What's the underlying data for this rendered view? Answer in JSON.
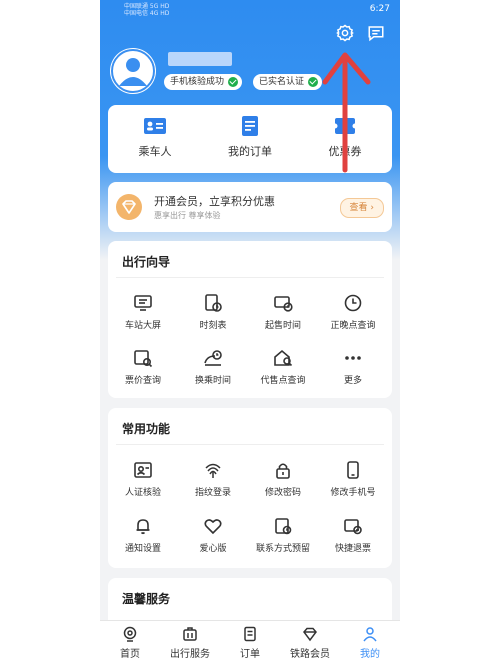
{
  "status_bar": {
    "carrier_1": "中国联通 5G HD",
    "carrier_2": "中国电信 4G HD",
    "time": "6:27"
  },
  "header": {
    "settings_icon": "gear-icon",
    "message_icon": "message-icon",
    "badges": [
      "手机核验成功",
      "已实名认证"
    ]
  },
  "quick_actions": [
    {
      "label": "乘车人",
      "icon": "id-card-icon"
    },
    {
      "label": "我的订单",
      "icon": "order-icon"
    },
    {
      "label": "优惠券",
      "icon": "coupon-icon"
    }
  ],
  "vip": {
    "title": "开通会员，立享积分优惠",
    "subtitle": "惠享出行 尊享体验",
    "button": "查看"
  },
  "travel_guide": {
    "title": "出行向导",
    "items": [
      "车站大屏",
      "时刻表",
      "起售时间",
      "正晚点查询",
      "票价查询",
      "换乘时间",
      "代售点查询",
      "更多"
    ]
  },
  "common_functions": {
    "title": "常用功能",
    "items": [
      "人证核验",
      "指纹登录",
      "修改密码",
      "修改手机号",
      "通知设置",
      "爱心版",
      "联系方式预留",
      "快捷退票"
    ]
  },
  "warm_service": {
    "title": "温馨服务"
  },
  "tabbar": {
    "items": [
      "首页",
      "出行服务",
      "订单",
      "铁路会员",
      "我的"
    ],
    "active_index": 4
  },
  "colors": {
    "primary": "#2e8cf0",
    "active_tab": "#3d8ff5",
    "annotation_arrow": "#e0413f"
  }
}
